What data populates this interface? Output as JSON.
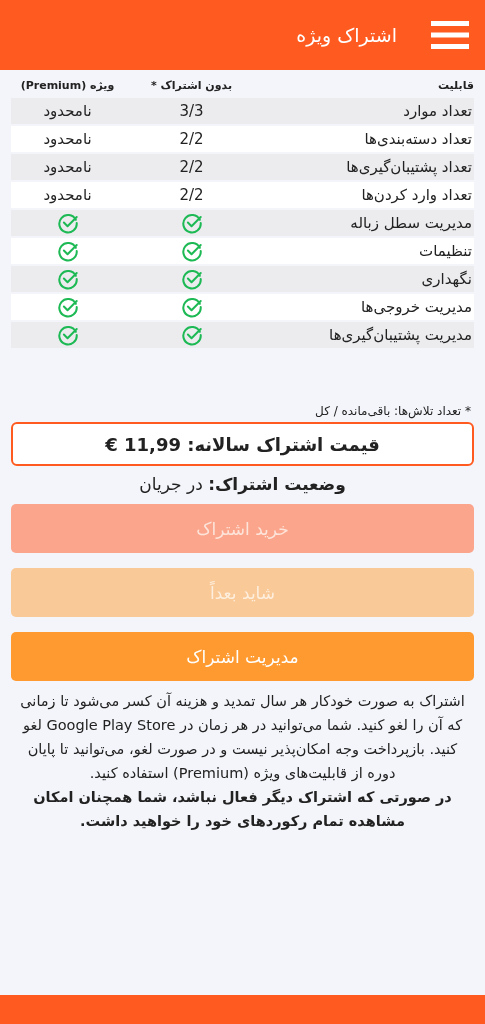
{
  "app_bar": {
    "title": "اشتراک ویژه"
  },
  "table": {
    "columns": [
      "قابلیت",
      "بدون اشتراک *",
      "ویژه (Premium)"
    ],
    "rows": [
      {
        "feature": "تعداد موارد",
        "free": {
          "kind": "text",
          "text": "3/3"
        },
        "premium": {
          "kind": "text",
          "text": "نامحدود"
        }
      },
      {
        "feature": "تعداد دسته‌بندی‌ها",
        "free": {
          "kind": "text",
          "text": "2/2"
        },
        "premium": {
          "kind": "text",
          "text": "نامحدود"
        }
      },
      {
        "feature": "تعداد پشتیبان‌گیری‌ها",
        "free": {
          "kind": "text",
          "text": "2/2"
        },
        "premium": {
          "kind": "text",
          "text": "نامحدود"
        }
      },
      {
        "feature": "تعداد وارد کردن‌ها",
        "free": {
          "kind": "text",
          "text": "2/2"
        },
        "premium": {
          "kind": "text",
          "text": "نامحدود"
        }
      },
      {
        "feature": "مدیریت سطل زباله",
        "free": {
          "kind": "check"
        },
        "premium": {
          "kind": "check"
        }
      },
      {
        "feature": "تنظیمات",
        "free": {
          "kind": "check"
        },
        "premium": {
          "kind": "check"
        }
      },
      {
        "feature": "نگهداری",
        "free": {
          "kind": "check"
        },
        "premium": {
          "kind": "check"
        }
      },
      {
        "feature": "مدیریت خروجی‌ها",
        "free": {
          "kind": "check"
        },
        "premium": {
          "kind": "check"
        }
      },
      {
        "feature": "مدیریت پشتیبان‌گیری‌ها",
        "free": {
          "kind": "check"
        },
        "premium": {
          "kind": "check"
        }
      }
    ]
  },
  "footnote": "* تعداد تلاش‌ها: باقی‌مانده / کل",
  "price": "قیمت اشتراک سالانه: 11,99 €",
  "status": "**وضعیت اشتراک:** در جریان",
  "buttons": [
    {
      "label": "خرید اشتراک",
      "kind": "primary",
      "disabled": true
    },
    {
      "label": "شاید بعداً",
      "kind": "secondary",
      "disabled": true
    },
    {
      "label": "مدیریت اشتراک",
      "kind": "secondary",
      "disabled": false
    }
  ],
  "description": "اشتراک به صورت خودکار هر سال تمدید و هزینه آن کسر می‌شود تا زمانی که آن را لغو کنید. شما می‌توانید در هر زمان در Google Play Store لغو کنید. بازپرداخت وجه امکان‌پذیر نیست و در صورت لغو، می‌توانید تا پایان دوره از قابلیت‌های ویژه (Premium) استفاده کنید.",
  "note": "در صورتی که اشتراک دیگر فعال نباشد، شما همچنان امکان مشاهده تمام رکوردهای خود را خواهید داشت."
}
